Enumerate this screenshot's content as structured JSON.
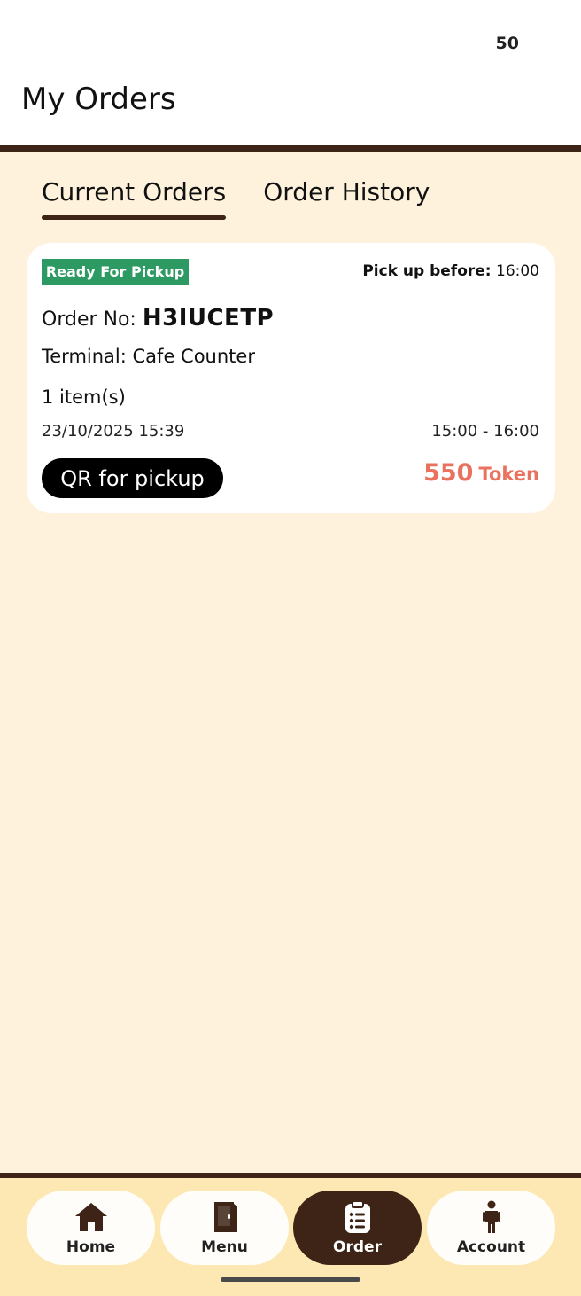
{
  "status_bar": {
    "count": "50"
  },
  "header": {
    "title": "My Orders"
  },
  "tabs": [
    {
      "label": "Current Orders",
      "active": true
    },
    {
      "label": "Order History",
      "active": false
    }
  ],
  "order": {
    "status": "Ready For Pickup",
    "pickup_before_label": "Pick up before:",
    "pickup_before_time": "16:00",
    "order_no_label": "Order No:",
    "order_no": "H3IUCETP",
    "terminal_label": "Terminal:",
    "terminal": "Cafe Counter",
    "item_count": "1 item(s)",
    "datetime": "23/10/2025 15:39",
    "pickup_window": "15:00 - 16:00",
    "qr_button_label": "QR for pickup",
    "price": "550",
    "price_unit": "Token"
  },
  "bottom_nav": [
    {
      "label": "Home",
      "icon": "home-icon",
      "active": false
    },
    {
      "label": "Menu",
      "icon": "menu-book-icon",
      "active": false
    },
    {
      "label": "Order",
      "icon": "order-list-icon",
      "active": true
    },
    {
      "label": "Account",
      "icon": "person-icon",
      "active": false
    }
  ],
  "colors": {
    "brand_dark": "#3d2416",
    "background": "#fef2dd",
    "nav_background": "#fde8b4",
    "status_green": "#2e9a63",
    "price_accent": "#e9725e"
  }
}
